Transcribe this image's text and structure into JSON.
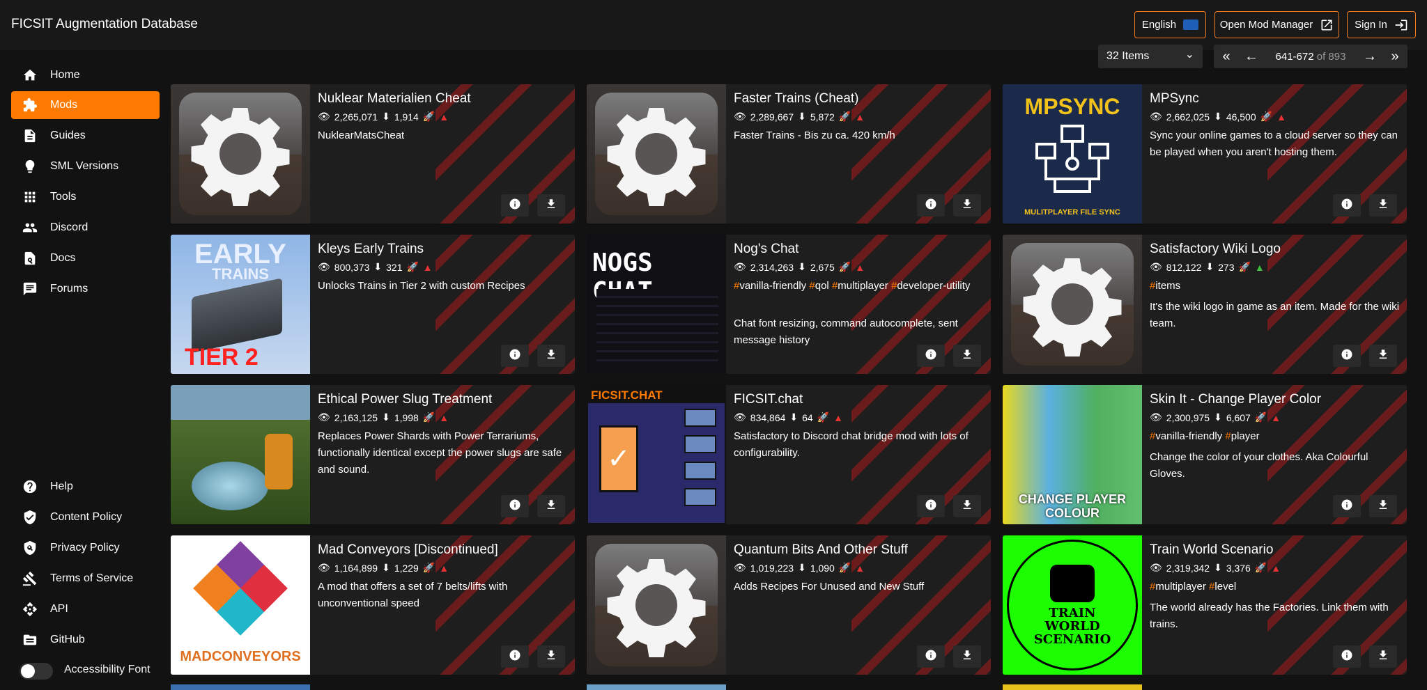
{
  "header": {
    "title": "FICSIT Augmentation Database",
    "language_label": "English",
    "mod_manager_label": "Open Mod Manager",
    "sign_in_label": "Sign In"
  },
  "sidebar": {
    "items": [
      {
        "label": "Home",
        "icon": "home-icon"
      },
      {
        "label": "Mods",
        "icon": "puzzle-icon",
        "active": true
      },
      {
        "label": "Guides",
        "icon": "document-icon"
      },
      {
        "label": "SML Versions",
        "icon": "lightbulb-icon"
      },
      {
        "label": "Tools",
        "icon": "grid-icon"
      },
      {
        "label": "Discord",
        "icon": "people-icon"
      },
      {
        "label": "Docs",
        "icon": "doc-search-icon"
      },
      {
        "label": "Forums",
        "icon": "forum-icon"
      }
    ],
    "footer_items": [
      {
        "label": "Help",
        "icon": "help-icon"
      },
      {
        "label": "Content Policy",
        "icon": "shield-check-icon"
      },
      {
        "label": "Privacy Policy",
        "icon": "shield-search-icon"
      },
      {
        "label": "Terms of Service",
        "icon": "gavel-icon"
      },
      {
        "label": "API",
        "icon": "api-icon"
      },
      {
        "label": "GitHub",
        "icon": "folder-icon"
      }
    ],
    "accessibility_label": "Accessibility Font"
  },
  "controls": {
    "items_per_page": "32 Items",
    "range": "641-672",
    "of_total": "of 893"
  },
  "cards": [
    {
      "title": "Nuklear Materialien Cheat",
      "views": "2,265,071",
      "downloads": "1,914",
      "tags": [],
      "desc": "NuklearMatsCheat",
      "thumb": "gear",
      "compat": "red"
    },
    {
      "title": "Faster Trains (Cheat)",
      "views": "2,289,667",
      "downloads": "5,872",
      "tags": [],
      "desc": "Faster Trains - Bis zu ca. 420 km/h",
      "thumb": "gear",
      "compat": "red"
    },
    {
      "title": "MPSync",
      "views": "2,662,025",
      "downloads": "46,500",
      "tags": [],
      "desc": "Sync your online games to a cloud server so they can be played when you aren't hosting them.",
      "thumb": "mpsync",
      "thumb_text": "MPSYNC",
      "thumb_sub": "MULITPLAYER FILE SYNC",
      "compat": "red"
    },
    {
      "title": "Kleys Early Trains",
      "views": "800,373",
      "downloads": "321",
      "tags": [],
      "desc": "Unlocks Trains in Tier 2 with custom Recipes",
      "thumb": "early",
      "thumb_text": "EARLY",
      "thumb_sub": "TRAINS",
      "thumb_tier": "TIER 2",
      "compat": "red"
    },
    {
      "title": "Nog's Chat",
      "views": "2,314,263",
      "downloads": "2,675",
      "tags": [
        "vanilla-friendly",
        "qol",
        "multiplayer",
        "developer-utility"
      ],
      "desc": "Chat font resizing, command autocomplete, sent message history",
      "thumb": "nogs",
      "thumb_text": "NOGS CHAT",
      "compat": "red"
    },
    {
      "title": "Satisfactory Wiki Logo",
      "views": "812,122",
      "downloads": "273",
      "tags": [
        "items"
      ],
      "desc": "It's the wiki logo in game as an item. Made for the wiki team.",
      "thumb": "gear",
      "compat": "green"
    },
    {
      "title": "Ethical Power Slug Treatment",
      "views": "2,163,125",
      "downloads": "1,998",
      "tags": [],
      "desc": "Replaces Power Shards with Power Terrariums, functionally identical except the power slugs are safe and sound.",
      "thumb": "slug",
      "compat": "red"
    },
    {
      "title": "FICSIT.chat",
      "views": "834,864",
      "downloads": "64",
      "tags": [],
      "desc": "Satisfactory to Discord chat bridge mod with lots of configurability.",
      "thumb": "ficsitchat",
      "thumb_text": "FICSIT.CHAT",
      "compat": "red"
    },
    {
      "title": "Skin It - Change Player Color",
      "views": "2,300,975",
      "downloads": "6,607",
      "tags": [
        "vanilla-friendly",
        "player"
      ],
      "desc": "Change the color of your clothes. Aka Colourful Gloves.",
      "thumb": "skin",
      "thumb_text": "CHANGE PLAYER COLOUR",
      "compat": "red"
    },
    {
      "title": "Mad Conveyors [Discontinued]",
      "views": "1,164,899",
      "downloads": "1,229",
      "tags": [],
      "desc": "A mod that offers a set of 7 belts/lifts with unconventional speed",
      "thumb": "mad",
      "thumb_text": "MADCONVEYORS",
      "compat": "red"
    },
    {
      "title": "Quantum Bits And Other Stuff",
      "views": "1,019,223",
      "downloads": "1,090",
      "tags": [],
      "desc": "Adds Recipes For Unused and New Stuff",
      "thumb": "gear",
      "compat": "red"
    },
    {
      "title": "Train World Scenario",
      "views": "2,319,342",
      "downloads": "3,376",
      "tags": [
        "multiplayer",
        "level"
      ],
      "desc": "The world already has the Factories. Link them with trains.",
      "thumb": "trainworld",
      "thumb_text": "TRAIN WORLD SCENARIO",
      "compat": "red"
    }
  ],
  "colors": {
    "accent": "#ff7a00",
    "background": "#121212",
    "card": "#1e1e1e",
    "stripe": "#8b1b1b",
    "compat_red": "#e53333",
    "compat_green": "#3fbf3f"
  }
}
